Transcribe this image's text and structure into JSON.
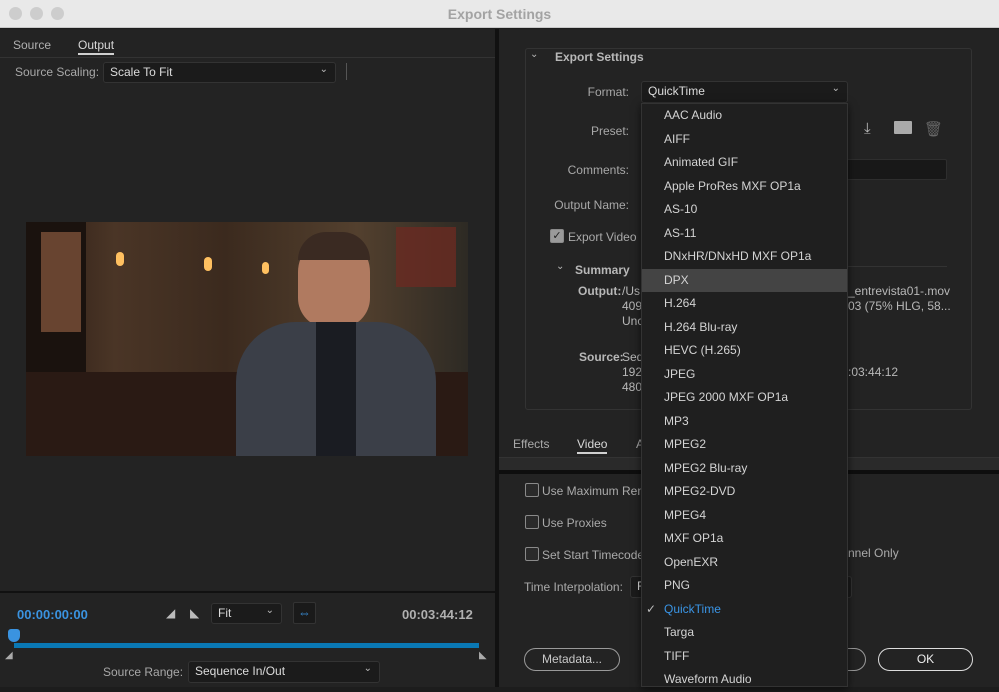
{
  "window": {
    "title": "Export Settings"
  },
  "left": {
    "tabs": [
      {
        "label": "Source"
      },
      {
        "label": "Output"
      }
    ],
    "source_scaling": {
      "label": "Source Scaling:",
      "value": "Scale To Fit"
    },
    "timecode_current": "00:00:00:00",
    "timecode_duration": "00:03:44:12",
    "zoom": {
      "value": "Fit"
    },
    "source_range": {
      "label": "Source Range:",
      "value": "Sequence In/Out"
    },
    "playhead_position": 0
  },
  "export_settings": {
    "heading": "Export Settings",
    "format": {
      "label": "Format:",
      "value": "QuickTime"
    },
    "preset": {
      "label": "Preset:"
    },
    "comments": {
      "label": "Comments:"
    },
    "output_name": {
      "label": "Output Name:",
      "value_visible": "_entrevista01-.mov"
    },
    "export_video": {
      "label": "Export Video",
      "checked": true
    },
    "summary": {
      "heading": "Summary",
      "output_label": "Output:",
      "output_lines": [
        "/Us",
        "409",
        "Unc"
      ],
      "output_right": [
        "_entrevista01-.mov",
        "03 (75% HLG, 58..."
      ],
      "source_label": "Source:",
      "source_lines": [
        "Seq",
        "192",
        "480"
      ],
      "source_right": ":03:44:12"
    }
  },
  "lower": {
    "tabs": [
      {
        "label": "Effects"
      },
      {
        "label": "Video"
      },
      {
        "label": "A"
      }
    ],
    "use_max_render": {
      "label": "Use Maximum Ren",
      "checked": false
    },
    "use_proxies": {
      "label": "Use Proxies",
      "checked": false
    },
    "set_start_timecode": {
      "label": "Set Start Timecode",
      "checked": false
    },
    "channel_only": "nnel Only",
    "time_interpolation": {
      "label": "Time Interpolation:",
      "value": "F"
    },
    "metadata_button": "Metadata...",
    "ok_button": "OK"
  },
  "format_menu": {
    "items": [
      "AAC Audio",
      "AIFF",
      "Animated GIF",
      "Apple ProRes MXF OP1a",
      "AS-10",
      "AS-11",
      "DNxHR/DNxHD MXF OP1a",
      "DPX",
      "H.264",
      "H.264 Blu-ray",
      "HEVC (H.265)",
      "JPEG",
      "JPEG 2000 MXF OP1a",
      "MP3",
      "MPEG2",
      "MPEG2 Blu-ray",
      "MPEG2-DVD",
      "MPEG4",
      "MXF OP1a",
      "OpenEXR",
      "PNG",
      "QuickTime",
      "Targa",
      "TIFF",
      "Waveform Audio"
    ],
    "highlighted": "DPX",
    "selected": "QuickTime"
  },
  "colors": {
    "accent": "#3a93e0",
    "timeline": "#0a78b4"
  }
}
